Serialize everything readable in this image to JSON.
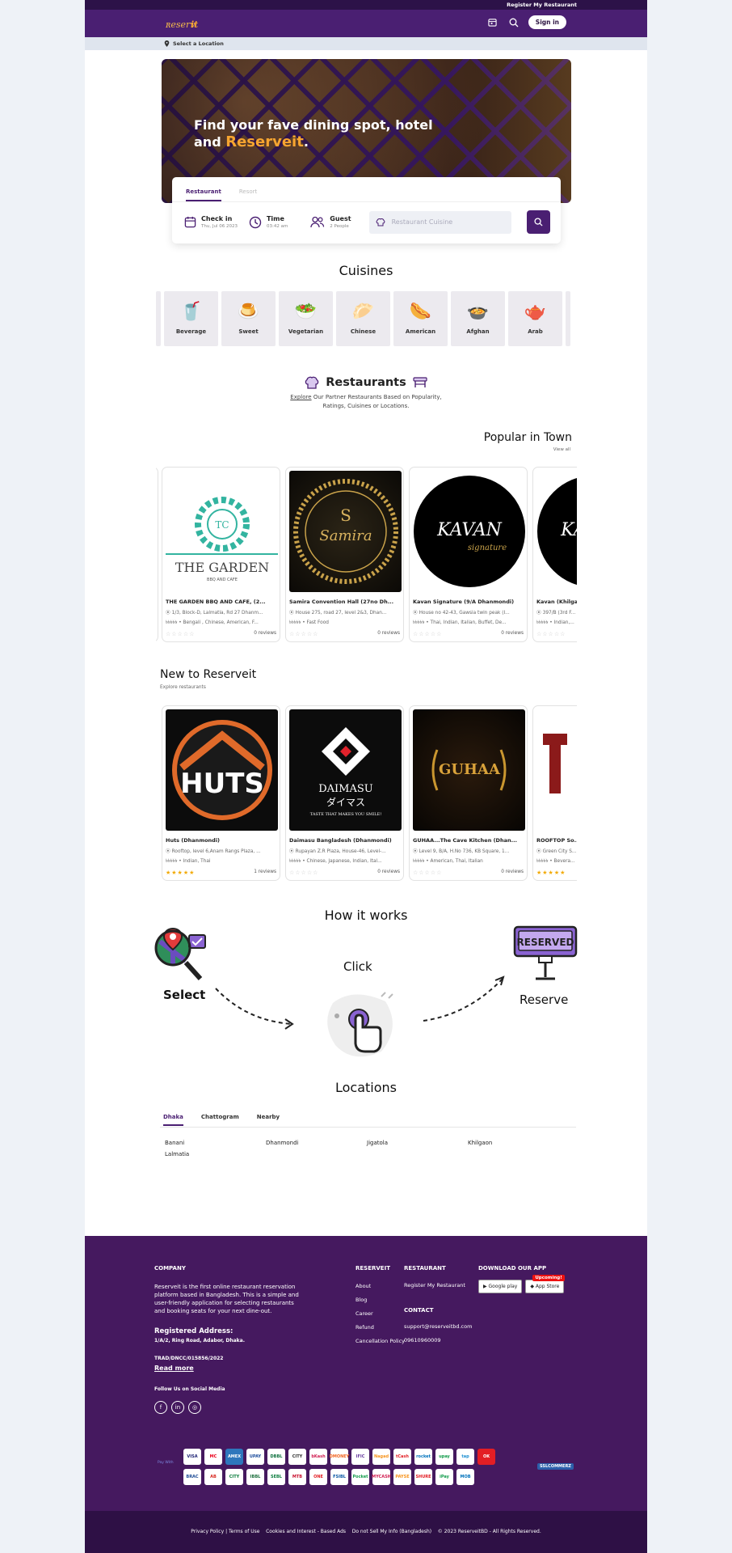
{
  "topbar": {
    "register_link": "Register My Restaurant"
  },
  "navbar": {
    "logo_text": "Reserveit",
    "signin_label": "Sign in"
  },
  "location_bar": {
    "label": "Select a Location"
  },
  "hero": {
    "line1": "Find your fave dining spot, hotel",
    "line2_prefix": "and",
    "brand": "Reserveit",
    "line2_suffix": "."
  },
  "search": {
    "tabs": [
      "Restaurant",
      "Resort"
    ],
    "checkin": {
      "label": "Check in",
      "value": "Thu, Jul 06 2023"
    },
    "time": {
      "label": "Time",
      "value": "03:42 am"
    },
    "guest": {
      "label": "Guest",
      "value": "2 People"
    },
    "placeholder": "Restaurant Cuisine"
  },
  "cuisines": {
    "title": "Cuisines",
    "items": [
      {
        "label": "Beverage",
        "icon": "🥤"
      },
      {
        "label": "Sweet",
        "icon": "🍮"
      },
      {
        "label": "Vegetarian",
        "icon": "🥗"
      },
      {
        "label": "Chinese",
        "icon": "🥟"
      },
      {
        "label": "American",
        "icon": "🌭"
      },
      {
        "label": "Afghan",
        "icon": "🍲"
      },
      {
        "label": "Arab",
        "icon": "🫖"
      }
    ]
  },
  "restaurants": {
    "title": "Restaurants",
    "sub_link": "Explore",
    "sub_rest1": "Our Partner Restaurants Based on Popularity,",
    "sub_rest2": "Ratings, Cuisines or Locations."
  },
  "popular": {
    "title": "Popular in Town",
    "view_all": "View all",
    "cards": [
      {
        "name": "THE GARDEN BBQ AND CAFE, (2...",
        "addr": "1/3, Block-D, Lalmatia, Rd 27 Dhanm...",
        "cats": "৳৳৳৳৳ • Bengali , Chinese, American, F...",
        "reviews": "0 reviews",
        "rating": 0
      },
      {
        "name": "Samira Convention Hall (27no Dh...",
        "addr": "House 275, road 27, level 2&3, Dhan...",
        "cats": "৳৳৳৳৳ • Fast Food",
        "reviews": "0 reviews",
        "rating": 0
      },
      {
        "name": "Kavan Signature (9/A Dhanmondi)",
        "addr": "House no 42-43, Gawsia twin peak (I...",
        "cats": "৳৳৳৳৳ • Thai, Indian, Italian, Buffet, De...",
        "reviews": "0 reviews",
        "rating": 0
      },
      {
        "name": "Kavan (Khilga...",
        "addr": "397/B (3rd F...",
        "cats": "৳৳৳৳৳ • Indian,...",
        "reviews": "",
        "rating": 0
      }
    ]
  },
  "new_to": {
    "title": "New to Reserveit",
    "subtitle": "Explore restaurants",
    "cards": [
      {
        "name": "Huts (Dhanmondi)",
        "addr": "Rooftop, level 6,Anam Rangs Plaza, ...",
        "cats": "৳৳৳৳৳ • Indian, Thai",
        "reviews": "1 reviews",
        "rating": 5
      },
      {
        "name": "Daimasu Bangladesh (Dhanmondi)",
        "addr": "Rupayan Z.R Plaza, House-46, Level-...",
        "cats": "৳৳৳৳৳ • Chinese, Japanese, Indian, Ital...",
        "reviews": "0 reviews",
        "rating": 0
      },
      {
        "name": "GUHAA...The Cave Kitchen (Dhan...",
        "addr": "Level 9, B/A, H.No 736, KB Square, 1...",
        "cats": "৳৳৳৳৳ • American, Thai, Italian",
        "reviews": "0 reviews",
        "rating": 0
      },
      {
        "name": "ROOFTOP So...",
        "addr": "Green City S...",
        "cats": "৳৳৳৳৳ • Bevera...",
        "reviews": "",
        "rating": 5
      }
    ],
    "logos": {
      "daimasu": "DAIMASU",
      "daimasu_jp": "ダイマス",
      "daimasu_tag": "TASTE THAT MAKES YOU SMILE!",
      "guhaa": "GUHAA",
      "huts": "HUTS",
      "garden": "THE GARDEN",
      "garden_sub": "BBQ AND CAFE",
      "samira": "Samira",
      "kavan": "KAVAN",
      "kavan_sig": "signature"
    }
  },
  "how": {
    "title": "How it works",
    "select": "Select",
    "click": "Click",
    "reserve": "Reserve",
    "sign_text": "RESERVED"
  },
  "locations": {
    "title": "Locations",
    "tabs": [
      "Dhaka",
      "Chattogram",
      "Nearby"
    ],
    "items": [
      "Banani",
      "Dhanmondi",
      "Jigatola",
      "Khilgaon",
      "Lalmatia"
    ]
  },
  "footer": {
    "company_h": "COMPANY",
    "company_p": "Reserveit is the first online restaurant reservation platform based in Bangladesh. This is a simple and user-friendly application for selecting restaurants and booking seats for your next dine-out.",
    "addr_h": "Registered Address:",
    "addr": "1/A/2, Ring Road, Adabor, Dhaka.",
    "trad": "TRAD/DNCC/015856/2022",
    "read_more": "Read more",
    "follow": "Follow Us on Social Media",
    "reserveit_h": "RESERVEIT",
    "reserveit_links": [
      "About",
      "Blog",
      "Career",
      "Refund",
      "Cancellation Policy"
    ],
    "restaurant_h": "RESTAURANT",
    "restaurant_link": "Register My Restaurant",
    "contact_h": "CONTACT",
    "email": "support@reserveitbd.com",
    "phone": "09610960009",
    "download_h": "DOWNLOAD OUR APP",
    "google_play": "Google play",
    "app_store": "App Store",
    "upcoming": "Upcoming!",
    "pay_with": "Pay With",
    "verified": "SSLCOMMERZ",
    "pay_row1": [
      "VISA",
      "MC",
      "AMEX",
      "UPAY",
      "DBBL",
      "CITY",
      "bKash",
      "DMONEY",
      "IFIC",
      "Nagad",
      "tCash",
      "rocket",
      "upay",
      "tap",
      "OK"
    ],
    "pay_row2": [
      "BRAC",
      "AB",
      "CITY",
      "IBBL",
      "SEBL",
      "MTB",
      "ONE",
      "FSIBL",
      "Pocket",
      "MYCASH",
      "PAYSE",
      "SHURE",
      "iPay",
      "MOB"
    ]
  },
  "copyright": {
    "privacy": "Privacy Policy | Terms of Use",
    "cookies": "Cookies and Interest - Based Ads",
    "dnsmi": "Do not Sell My Info (Bangladesh)",
    "rights": "© 2023 ReserveitBD - All Rights Reserved."
  }
}
